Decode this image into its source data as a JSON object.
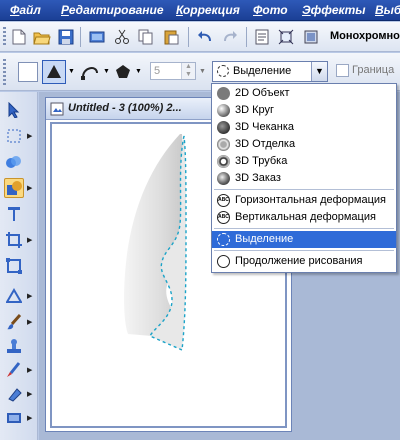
{
  "menubar": {
    "items": [
      {
        "first": "Ф",
        "rest": "айл"
      },
      {
        "first": "Р",
        "rest": "едактирование"
      },
      {
        "first": "К",
        "rest": "оррекция"
      },
      {
        "first": "Ф",
        "rest": "ото"
      },
      {
        "first": "Э",
        "rest": "ффекты"
      },
      {
        "first": "В",
        "rest": "ыб"
      }
    ]
  },
  "toolbar": {
    "mono_label": "Монохромно",
    "line_width_value": "5",
    "selection_mode": "Выделение",
    "border_label": "Граница"
  },
  "document": {
    "title": "Untitled - 3 (100%) 2..."
  },
  "dropdown": {
    "items": [
      {
        "label": "2D Объект",
        "icon": "2d-object-icon"
      },
      {
        "label": "3D Круг",
        "icon": "3d-round-icon"
      },
      {
        "label": "3D Чеканка",
        "icon": "3d-chisel-icon"
      },
      {
        "label": "3D Отделка",
        "icon": "3d-trim-icon"
      },
      {
        "label": "3D Трубка",
        "icon": "3d-tube-icon"
      },
      {
        "label": "3D Заказ",
        "icon": "3d-custom-icon"
      },
      {
        "label": "Горизонтальная деформация",
        "icon": "horizontal-warp-icon"
      },
      {
        "label": "Вертикальная деформация",
        "icon": "vertical-warp-icon"
      },
      {
        "label": "Выделение",
        "icon": "selection-marquee-icon"
      },
      {
        "label": "Продолжение рисования",
        "icon": "continue-drawing-icon"
      }
    ],
    "highlighted": "Выделение"
  },
  "colors": {
    "menubar": "#1f46a3",
    "highlight": "#2f6bd8",
    "active_tool": "#fbd980",
    "marquee": "#1aa3c8"
  }
}
